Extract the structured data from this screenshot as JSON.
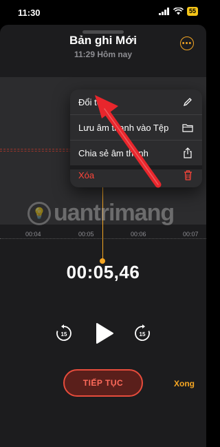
{
  "status": {
    "time": "11:30",
    "battery": "55"
  },
  "recording": {
    "title": "Bản ghi Mới",
    "subtitle": "11:29 Hôm nay"
  },
  "timeline": {
    "ticks": [
      "00:04",
      "00:05",
      "00:06",
      "00:07"
    ]
  },
  "watermark": {
    "text": "uantrimang"
  },
  "player": {
    "elapsed": "00:05,46",
    "skip_back": "15",
    "skip_forward": "15"
  },
  "actions": {
    "resume": "TIẾP TỤC",
    "done": "Xong"
  },
  "menu": {
    "items": [
      {
        "label": "Đổi tên",
        "icon": "pencil-icon"
      },
      {
        "label": "Lưu âm thanh vào Tệp",
        "icon": "folder-icon"
      },
      {
        "label": "Chia sẻ âm thanh",
        "icon": "share-icon"
      },
      {
        "label": "Xóa",
        "icon": "trash-icon"
      }
    ]
  },
  "colors": {
    "accent": "#f5a623",
    "danger": "#ff453a",
    "arrow": "#e8262c"
  }
}
